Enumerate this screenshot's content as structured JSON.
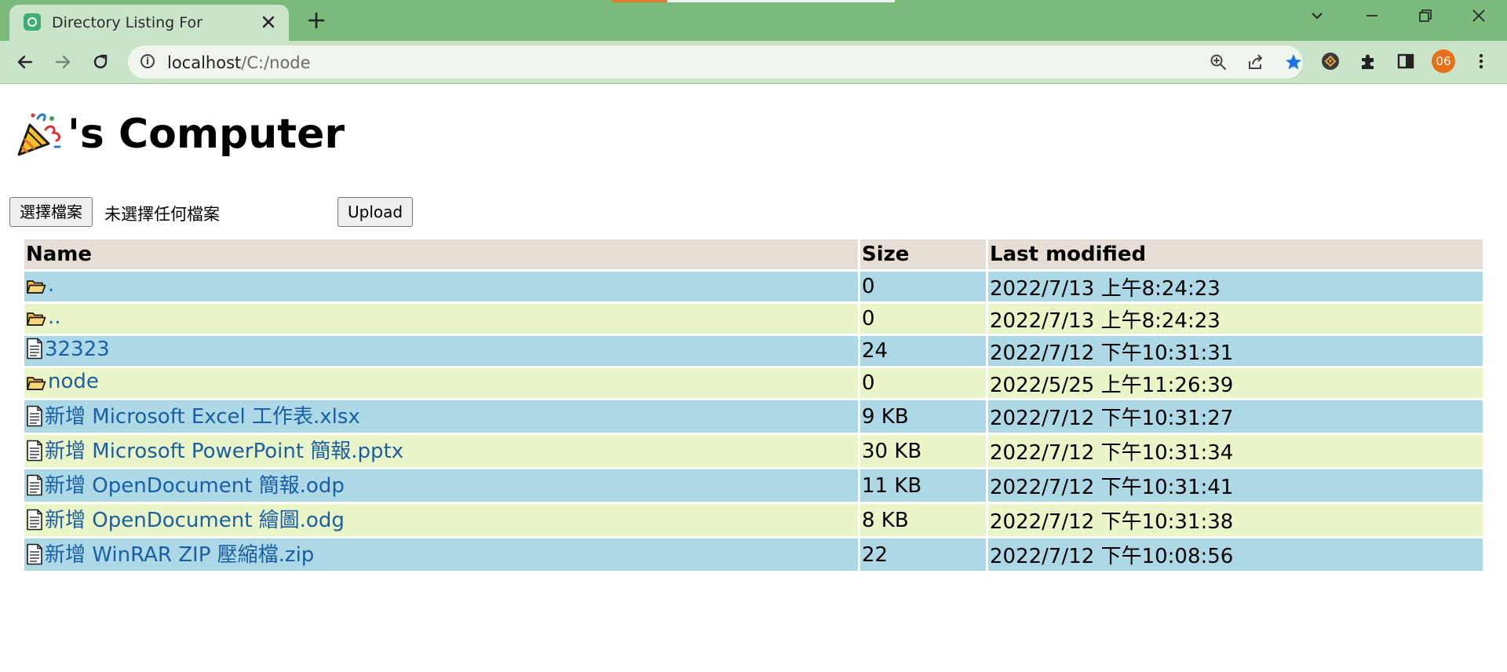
{
  "browser": {
    "tab_title": "Directory Listing For",
    "url_host": "localhost",
    "url_path": "/C:/node",
    "profile_initials": "06"
  },
  "page": {
    "heading": "'s Computer",
    "choose_file_label": "選擇檔案",
    "no_file_text": "未選擇任何檔案",
    "upload_label": "Upload"
  },
  "table": {
    "headers": {
      "name": "Name",
      "size": "Size",
      "modified": "Last modified"
    },
    "rows": [
      {
        "type": "folder",
        "name": ".",
        "size": "0",
        "modified": "2022/7/13 上午8:24:23"
      },
      {
        "type": "folder",
        "name": "..",
        "size": "0",
        "modified": "2022/7/13 上午8:24:23"
      },
      {
        "type": "file",
        "name": "32323",
        "size": "24",
        "modified": "2022/7/12 下午10:31:31"
      },
      {
        "type": "folder",
        "name": "node",
        "size": "0",
        "modified": "2022/5/25 上午11:26:39"
      },
      {
        "type": "file",
        "name": "新增 Microsoft Excel 工作表.xlsx",
        "size": "9 KB",
        "modified": "2022/7/12 下午10:31:27"
      },
      {
        "type": "file",
        "name": "新增 Microsoft PowerPoint 簡報.pptx",
        "size": "30 KB",
        "modified": "2022/7/12 下午10:31:34"
      },
      {
        "type": "file",
        "name": "新增 OpenDocument 簡報.odp",
        "size": "11 KB",
        "modified": "2022/7/12 下午10:31:41"
      },
      {
        "type": "file",
        "name": "新增 OpenDocument 繪圖.odg",
        "size": "8 KB",
        "modified": "2022/7/12 下午10:31:38"
      },
      {
        "type": "file",
        "name": "新增 WinRAR ZIP 壓縮檔.zip",
        "size": "22",
        "modified": "2022/7/12 下午10:08:56"
      }
    ]
  },
  "colors": {
    "tabbar": "#7aba7a",
    "toolbar": "#c9e4c9",
    "header_row": "#e6ddd4",
    "row_odd": "#add8e6",
    "row_even": "#eaf5c8",
    "link": "#1a5fa6",
    "profile": "#e8701a"
  },
  "icons": {
    "tab_favicon": "app-favicon-icon",
    "folder": "folder-icon",
    "file": "file-icon",
    "heading": "party-popper-icon"
  }
}
